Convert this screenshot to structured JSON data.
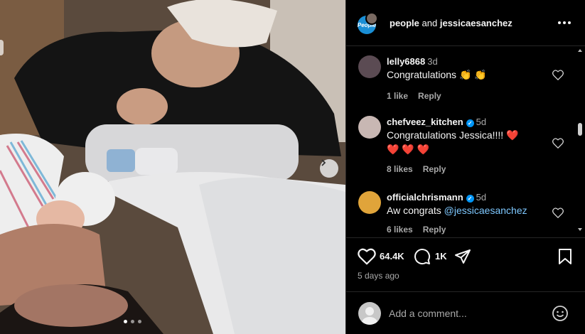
{
  "post": {
    "media_alt": "Couple with newborn baby in hospital bed",
    "carousel": {
      "dots": 3,
      "active": 0
    }
  },
  "header": {
    "account_1": "people",
    "joiner": "and",
    "account_2": "jessicaesanchez",
    "people_logo_text": "People"
  },
  "comments": [
    {
      "user": "lelly6868",
      "time": "3d",
      "verified": false,
      "text": "Congratulations 👏 👏",
      "likes": "1 like",
      "reply": "Reply",
      "avatar_color": "#5b4b53"
    },
    {
      "user": "chefveez_kitchen",
      "time": "5d",
      "verified": true,
      "text": "Congratulations Jessica!!!! ❤️",
      "text2": "❤️ ❤️ ❤️",
      "likes": "8 likes",
      "reply": "Reply",
      "avatar_color": "#c8b7b3"
    },
    {
      "user": "officialchrismann",
      "time": "5d",
      "verified": true,
      "text_prefix": "Aw congrats ",
      "mention": "@jessicaesanchez",
      "likes": "6 likes",
      "reply": "Reply",
      "avatar_color": "#e0a43a"
    }
  ],
  "actions": {
    "like_count": "64.4K",
    "comment_count": "1K",
    "posted": "5 days ago"
  },
  "composer": {
    "placeholder": "Add a comment..."
  }
}
